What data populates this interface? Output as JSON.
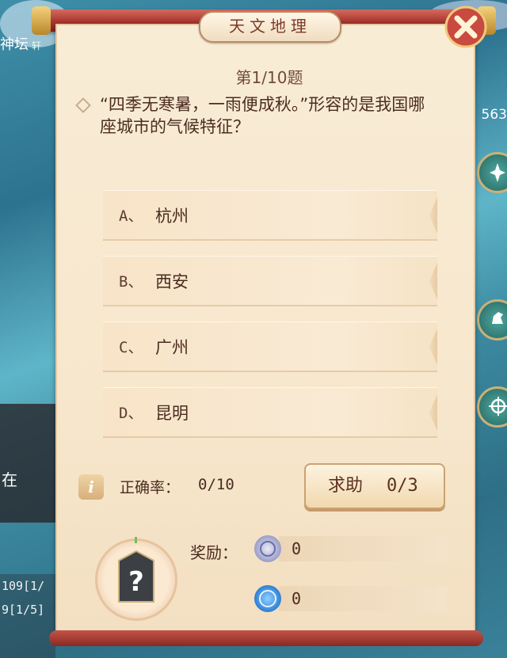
{
  "background": {
    "top_left_label": "神坛",
    "top_left_small": "轩",
    "left_panel_text": "在",
    "right_number": "563",
    "chat_lines": [
      "109[1/",
      "9[1/5]"
    ]
  },
  "dialog": {
    "title": "天文地理",
    "close_icon": "close-icon",
    "question_number": "第1/10题",
    "question_text": "“四季无寒暑，一雨便成秋。”形容的是我国哪座城市的气候特征？",
    "options": [
      {
        "letter": "A、",
        "text": "杭州"
      },
      {
        "letter": "B、",
        "text": "西安"
      },
      {
        "letter": "C、",
        "text": "广州"
      },
      {
        "letter": "D、",
        "text": "昆明"
      }
    ],
    "accuracy_label": "正确率：",
    "accuracy_value": "0/10",
    "help_label": "求助",
    "help_count": "0/3",
    "reward_label": "奖励：",
    "rewards": [
      {
        "icon": "silver-coin-icon",
        "value": "0"
      },
      {
        "icon": "experience-icon",
        "value": "0"
      }
    ]
  },
  "colors": {
    "paper": "#f8ecd5",
    "scroll_red": "#a9362f",
    "title_text": "#7c3a28",
    "body_text": "#4a2b20"
  }
}
